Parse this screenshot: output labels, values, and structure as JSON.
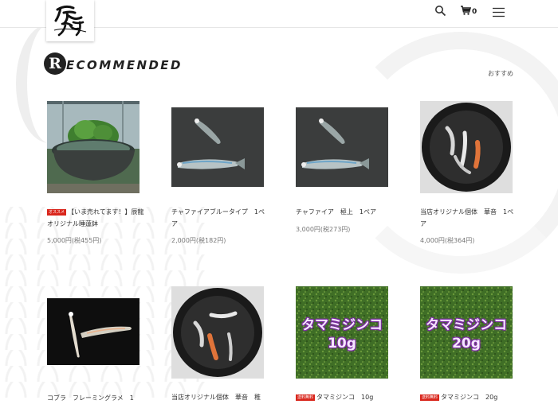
{
  "header": {
    "cart_count": "0"
  },
  "section": {
    "title_initial": "R",
    "title_rest": "ECOMMENDED",
    "subtitle": "おすすめ"
  },
  "products": [
    {
      "name": "【いま売れてます！】辰龍オリジナル睡蓮鉢",
      "tag": "オススメ",
      "price": "5,000円(税455円)"
    },
    {
      "name": "チャファイアブルータイプ　1ペア",
      "price": "2,000円(税182円)"
    },
    {
      "name": "チャファイア　極上　1ペア",
      "price": "3,000円(税273円)"
    },
    {
      "name": "当店オリジナル個体　華音　1ペア",
      "price": "4,000円(税364円)"
    },
    {
      "name": "コブラ　フレーミングラメ　1"
    },
    {
      "name": "当店オリジナル個体　華音　稚"
    },
    {
      "name": "タマミジンコ　10g",
      "tag": "送料無料",
      "image_text_1": "タマミジンコ",
      "image_text_2": "10g"
    },
    {
      "name": "タマミジンコ　20g",
      "tag": "送料無料",
      "image_text_1": "タマミジンコ",
      "image_text_2": "20g"
    }
  ],
  "colors": {
    "accent": "#d9261c",
    "text": "#333333",
    "price": "#777777"
  }
}
